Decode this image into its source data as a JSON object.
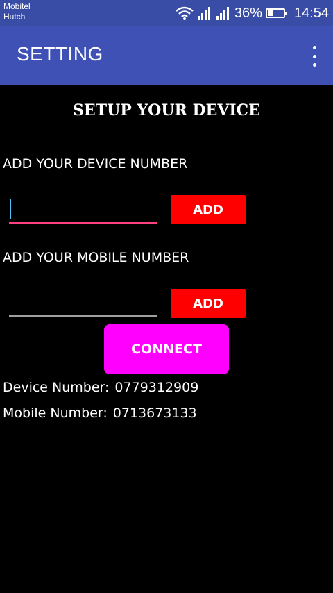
{
  "status_bar": {
    "carriers": [
      "Mobitel",
      "Hutch"
    ],
    "battery_percent": "36%",
    "battery_level": 0.36,
    "time": "14:54",
    "icons": [
      "wifi-icon",
      "signal-icon",
      "signal-icon",
      "battery-icon"
    ]
  },
  "app_bar": {
    "title": "SETTING",
    "menu_icon": "overflow-menu-icon",
    "background": "#3F51B5"
  },
  "content": {
    "heading": "SETUP YOUR DEVICE",
    "device_section": {
      "label": "ADD YOUR DEVICE NUMBER",
      "input_value": "",
      "button_label": "ADD"
    },
    "mobile_section": {
      "label": "ADD YOUR MOBILE NUMBER",
      "input_value": "",
      "button_label": "ADD"
    },
    "connect_label": "CONNECT",
    "device_info": {
      "label": "Device Number:",
      "value": "0779312909"
    },
    "mobile_info": {
      "label": "Mobile Number:",
      "value": "0713673133"
    }
  },
  "colors": {
    "add_button": "#FF0000",
    "connect_button": "#FF00FF",
    "focus_underline": "#FF4081",
    "cursor": "#4FC3F7",
    "background": "#000000"
  }
}
